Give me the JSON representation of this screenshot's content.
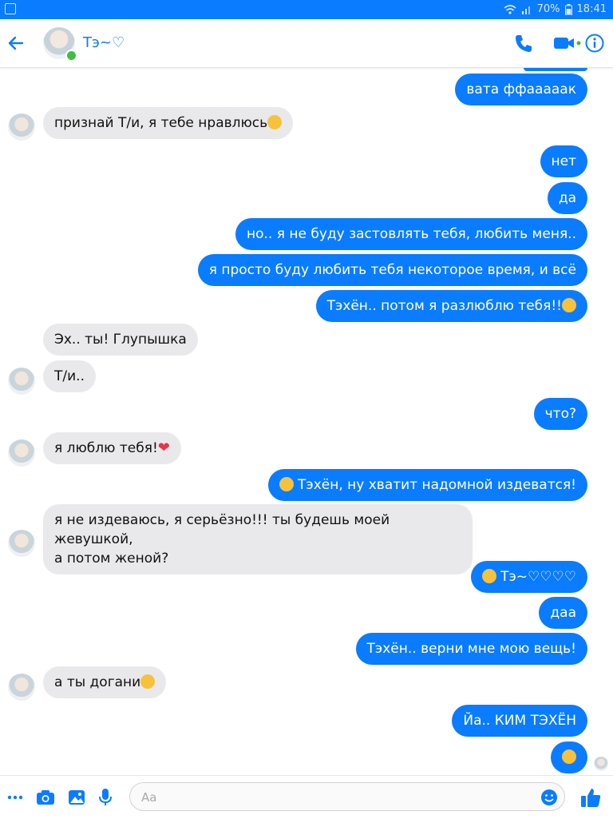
{
  "status_bar": {
    "battery": "70%",
    "time": "18:41"
  },
  "header": {
    "contact_name": "Тэ~♡"
  },
  "messages": [
    {
      "side": "me",
      "text": "вата ффааааак"
    },
    {
      "side": "them",
      "text": "признай Т/и, я тебе нравлюсь",
      "emoji": "kiss-face"
    },
    {
      "side": "me",
      "text": "нет"
    },
    {
      "side": "me",
      "text": "да"
    },
    {
      "side": "me",
      "text": "но.. я не буду застовлять тебя, любить меня.."
    },
    {
      "side": "me",
      "text": "я просто буду любить тебя некоторое время, и всё"
    },
    {
      "side": "me",
      "text": "Тэхён.. потом я разлюблю тебя!!",
      "emoji": "sad-face"
    },
    {
      "side": "them",
      "text": "Эх.. ты! Глупышка"
    },
    {
      "side": "them",
      "text": "Т/и.."
    },
    {
      "side": "me",
      "text": "что?"
    },
    {
      "side": "them",
      "text": "я люблю тебя!",
      "emoji": "heart"
    },
    {
      "side": "me",
      "text": "Тэхён, ну хватит надомной   издеватся!",
      "emoji": "surprised-face"
    },
    {
      "side": "them",
      "text": "я не издеваюсь, я серьёзно!!! ты будешь моей жевушкой,",
      "text2": "а потом женой?"
    },
    {
      "side": "me",
      "text": "Тэ~♡♡♡♡",
      "emoji": "sad-face"
    },
    {
      "side": "me",
      "text": "даа"
    },
    {
      "side": "me",
      "text": "Тэхён.. верни мне мою вещь!"
    },
    {
      "side": "them",
      "text": "а ты догани",
      "emoji": "laughing-face"
    },
    {
      "side": "me",
      "text": "Йа.. КИМ ТЭХЁН"
    },
    {
      "side": "me",
      "text": "",
      "emoji": "laughing-face"
    }
  ],
  "composer": {
    "placeholder": "Aa"
  },
  "colors": {
    "accent": "#0a7cff",
    "incoming": "#e9e9eb",
    "online": "#3fbe3f"
  },
  "icons": [
    "back-arrow-icon",
    "phone-icon",
    "video-icon",
    "info-icon",
    "more-icon",
    "camera-icon",
    "gallery-icon",
    "mic-icon",
    "smile-icon",
    "like-icon"
  ]
}
